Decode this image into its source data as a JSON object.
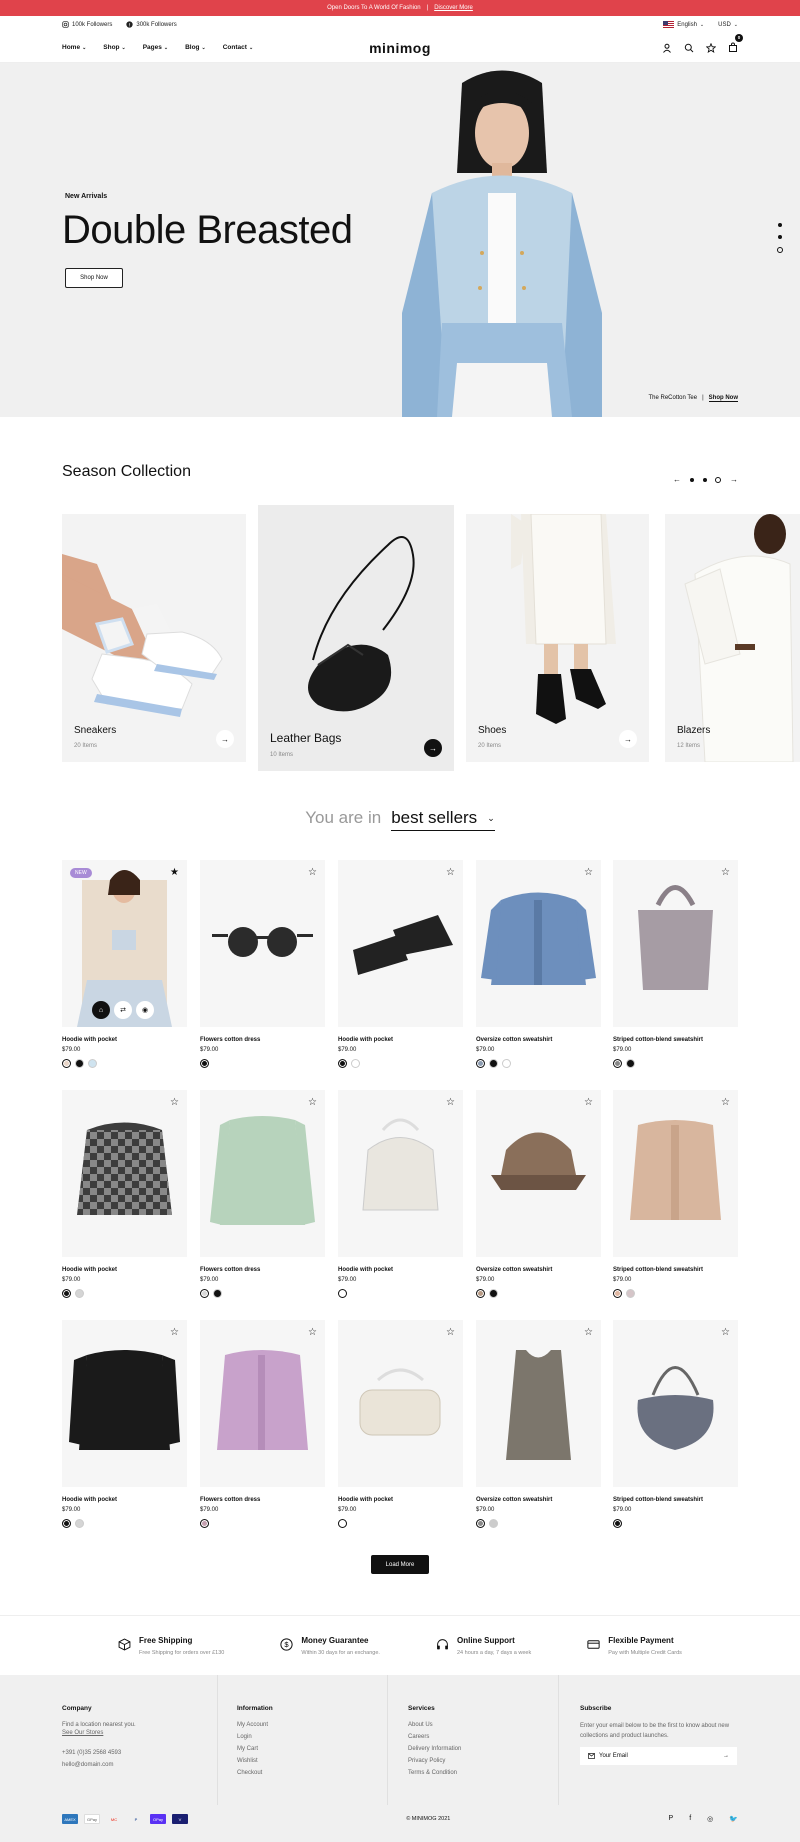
{
  "topbar": {
    "promo": "Open Doors To A World Of Fashion",
    "sep": "|",
    "link": "Discover More"
  },
  "subbar": {
    "instagram": "100k Followers",
    "facebook": "300k Followers",
    "language": "English",
    "currency": "USD"
  },
  "nav": {
    "logo": "minimog",
    "menu": [
      "Home",
      "Shop",
      "Pages",
      "Blog",
      "Contact"
    ],
    "cart_count": "0"
  },
  "hero": {
    "subtitle": "New Arrivals",
    "title": "Double Breasted",
    "cta": "Shop Now",
    "credit": "The ReCotton Tee",
    "credit_sep": "|",
    "credit_link": "Shop Now"
  },
  "season": {
    "title": "Season Collection",
    "categories": [
      {
        "name": "Sneakers",
        "count": "20 Items"
      },
      {
        "name": "Leather Bags",
        "count": "10 Items"
      },
      {
        "name": "Shoes",
        "count": "20 Items"
      },
      {
        "name": "Blazers",
        "count": "12 Items"
      }
    ]
  },
  "filter": {
    "prefix": "You are in",
    "selected": "best sellers"
  },
  "products": [
    {
      "title": "Hoodie with pocket",
      "price": "$79.00",
      "badge": "NEW",
      "swatches": [
        "#e9d5c7",
        "#111111",
        "#cfe3ef"
      ]
    },
    {
      "title": "Flowers cotton dress",
      "price": "$79.00",
      "swatches": [
        "#111111"
      ]
    },
    {
      "title": "Hoodie with pocket",
      "price": "$79.00",
      "swatches": [
        "#111111",
        "#ffffff"
      ]
    },
    {
      "title": "Oversize cotton sweatshirt",
      "price": "$79.00",
      "swatches": [
        "#8b9bb0",
        "#111111",
        "#ffffff"
      ]
    },
    {
      "title": "Striped cotton-blend sweatshirt",
      "price": "$79.00",
      "swatches": [
        "#888888",
        "#111111"
      ]
    },
    {
      "title": "Hoodie with pocket",
      "price": "$79.00",
      "swatches": [
        "#111111",
        "#d5d5d5"
      ]
    },
    {
      "title": "Flowers cotton dress",
      "price": "$79.00",
      "swatches": [
        "#d9d9d9",
        "#111111"
      ]
    },
    {
      "title": "Hoodie with pocket",
      "price": "$79.00",
      "swatches": [
        "#ffffff"
      ]
    },
    {
      "title": "Oversize cotton sweatshirt",
      "price": "$79.00",
      "swatches": [
        "#b79a84",
        "#111111"
      ]
    },
    {
      "title": "Striped cotton-blend sweatshirt",
      "price": "$79.00",
      "swatches": [
        "#e0b6a0",
        "#d5c5c8"
      ]
    },
    {
      "title": "Hoodie with pocket",
      "price": "$79.00",
      "swatches": [
        "#111111",
        "#d5d5d5"
      ]
    },
    {
      "title": "Flowers cotton dress",
      "price": "$79.00",
      "swatches": [
        "#c5a0b0"
      ]
    },
    {
      "title": "Hoodie with pocket",
      "price": "$79.00",
      "swatches": [
        "#ffffff"
      ]
    },
    {
      "title": "Oversize cotton sweatshirt",
      "price": "$79.00",
      "swatches": [
        "#888888",
        "#cccccc"
      ]
    },
    {
      "title": "Striped cotton-blend sweatshirt",
      "price": "$79.00",
      "swatches": [
        "#111111"
      ]
    }
  ],
  "load_more": "Load More",
  "features": [
    {
      "title": "Free Shipping",
      "desc": "Free Shipping for orders over £130"
    },
    {
      "title": "Money Guarantee",
      "desc": "Within 30 days for an exchange."
    },
    {
      "title": "Online Support",
      "desc": "24 hours a day, 7 days a week"
    },
    {
      "title": "Flexible Payment",
      "desc": "Pay with Multiple Credit Cards"
    }
  ],
  "footer": {
    "company": {
      "title": "Company",
      "text": "Find a location nearest you.",
      "link": "See Our Stores",
      "phone": "+391 (0)35 2568 4593",
      "email": "hello@domain.com"
    },
    "information": {
      "title": "Information",
      "links": [
        "My Account",
        "Login",
        "My Cart",
        "Wishlist",
        "Checkout"
      ]
    },
    "services": {
      "title": "Services",
      "links": [
        "About Us",
        "Careers",
        "Delivery Information",
        "Privacy Policy",
        "Terms & Condition"
      ]
    },
    "subscribe": {
      "title": "Subscribe",
      "text": "Enter your email below to be the first to know about new collections and product launches.",
      "placeholder": "Your Email"
    },
    "copyright": "© MINIMOG 2021",
    "payments": [
      "AMEX",
      "GPay",
      "MC",
      "P",
      "OPay",
      "V"
    ]
  },
  "colors": {
    "promo_bar": "#e0434b",
    "badge_new": "#a88bd6",
    "hero_bg": "#f0f0f0",
    "footer_bg": "#f0f0f0"
  }
}
